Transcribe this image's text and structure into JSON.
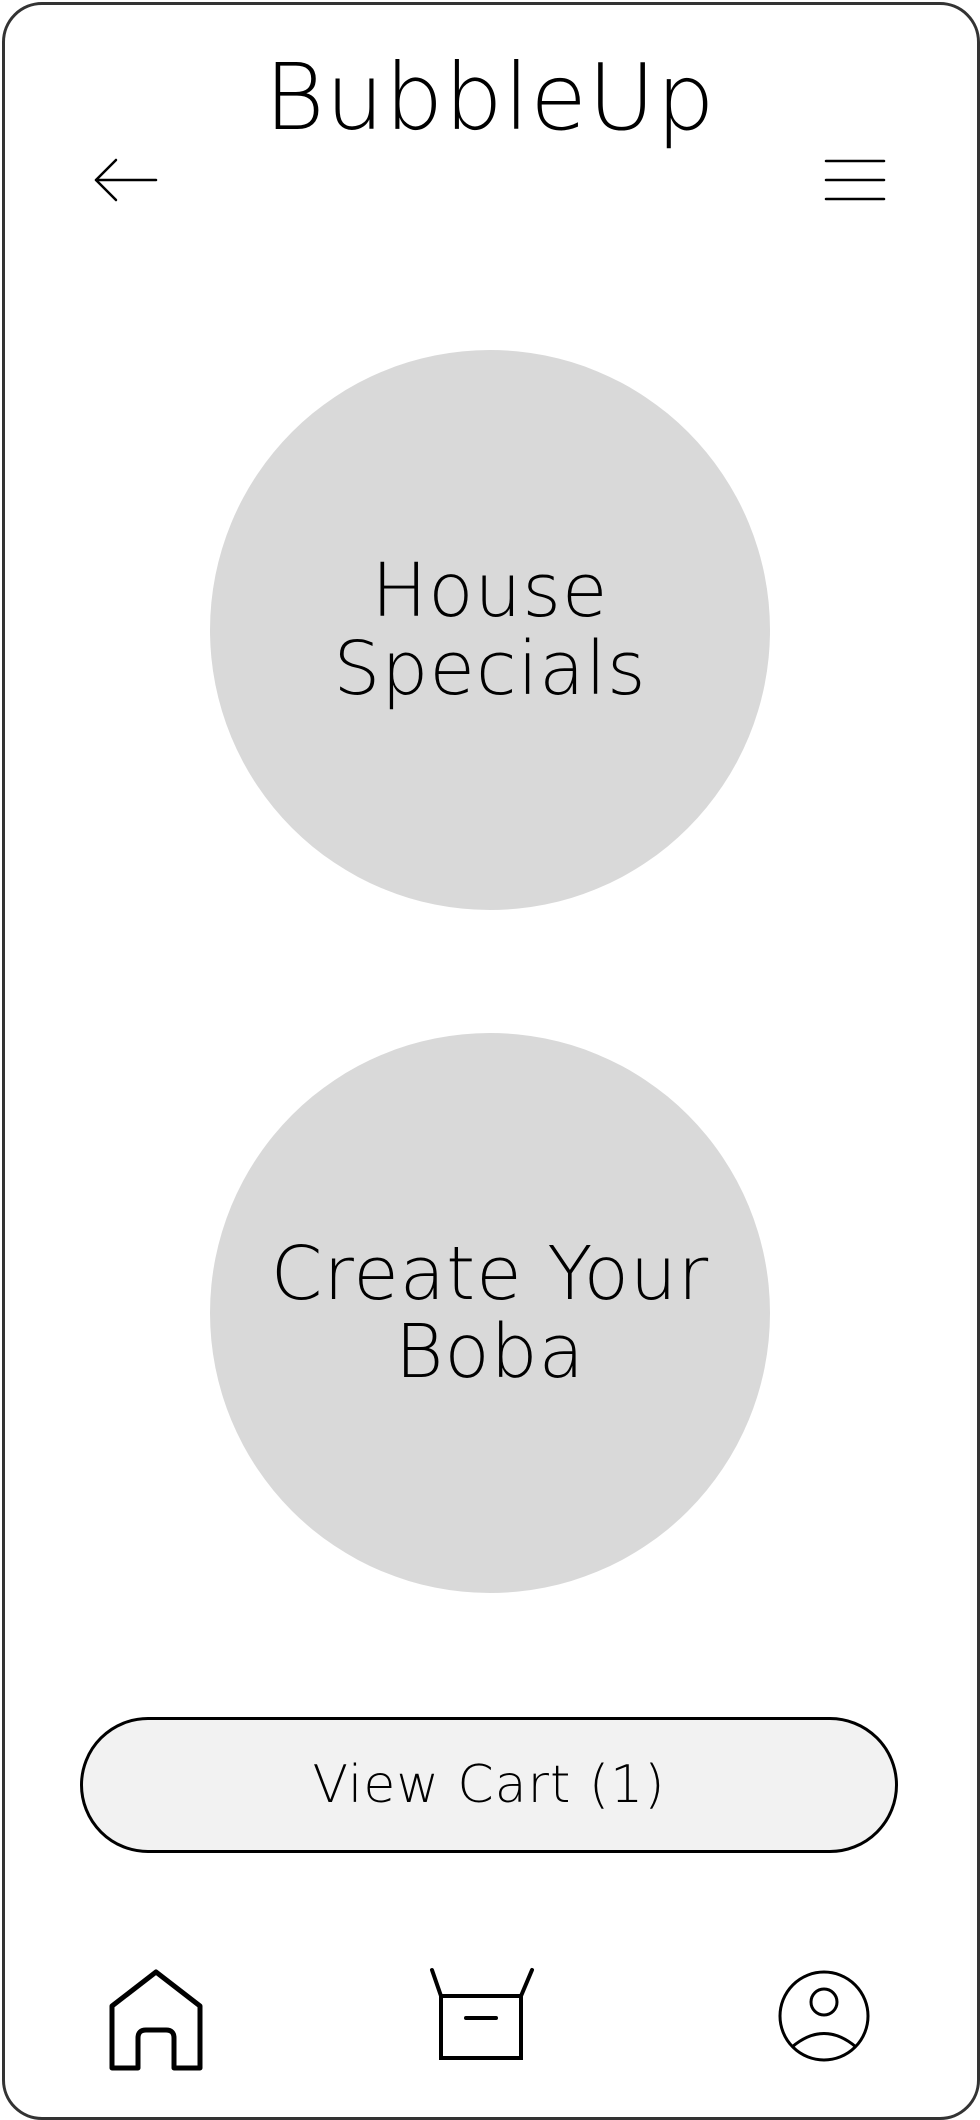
{
  "app": {
    "title": "BubbleUp"
  },
  "header": {
    "back_icon": "arrow-left-icon",
    "menu_icon": "hamburger-menu-icon"
  },
  "main": {
    "options": [
      {
        "label": "House\nSpecials"
      },
      {
        "label": "Create Your\nBoba"
      }
    ]
  },
  "cart": {
    "label": "View Cart (1)"
  },
  "bottom_nav": {
    "items": [
      {
        "icon": "home-icon"
      },
      {
        "icon": "open-box-icon"
      },
      {
        "icon": "user-profile-icon"
      }
    ]
  },
  "colors": {
    "circle_bg": "#d9d9d9",
    "cart_bg": "#f2f2f2",
    "frame_border": "#333333"
  }
}
